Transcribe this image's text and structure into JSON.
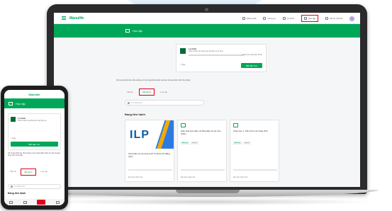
{
  "colors": {
    "brand_green": "#00a758",
    "highlight_red": "#e0001b",
    "ilp_blue": "#0f5ba8"
  },
  "brand": "Manulife",
  "topnav": {
    "links": [
      {
        "label": "Khám phá",
        "icon": "compass-icon"
      },
      {
        "label": "Công cụ",
        "icon": "tools-icon"
      },
      {
        "label": "Lộ trình",
        "icon": "route-icon"
      },
      {
        "label": "Học tập",
        "icon": "book-icon",
        "active": true
      },
      {
        "label": "Hồ sơ của tôi",
        "icon": "profile-icon"
      }
    ]
  },
  "header": {
    "title": "Học tập"
  },
  "program": {
    "title": "Lộ trình",
    "description": "Hoàn thành các khóa học để tiếp tục lộ trình",
    "status": "0 khóa học đã hoàn thành",
    "days": "7 ngày",
    "button": "Bắt đầu học"
  },
  "notice": "Tất cả các khóa học đã và đang có trên bảng điều khiển học tập của bạn được hiển thị tại đây.",
  "tabs": [
    "Tất cả",
    "Đã thích",
    "Lưu lại"
  ],
  "search": {
    "placeholder": "Tìm khóa học"
  },
  "section_title": "Đang tiến hành",
  "courses": [
    {
      "thumb_text": "ILP",
      "title": "Giới thiệu về chương trình Trưởng Tài Năng (ILP)",
      "footer": "Đã hoàn thành 0/1"
    },
    {
      "title": "Hiểu biết toàn diện về Manulife và các sản phẩm",
      "tags": [
        "Bắt buộc",
        "10 phút"
      ],
      "footer": "Đã hoàn thành 0/1"
    },
    {
      "title": "Khóa học 1: Kiến thức nền tảng (P2)",
      "tags": [
        "Bắt buộc",
        "10 phút"
      ],
      "footer": "Đã hoàn thành 0/1"
    }
  ],
  "phone": {
    "brand": "Manulife",
    "header_title": "Học tập",
    "program_title": "Lộ trình",
    "program_desc": "Hoàn thành các khóa học để tiếp tục",
    "program_days": "7 ngày",
    "program_button": "Bắt đầu học",
    "notice": "Tất cả các khóa học đã và đang có trên bảng điều khiển học tập của bạn được hiển thị tại đây.",
    "tabs": [
      "Tất cả",
      "Đã thích",
      "Lưu lại"
    ],
    "search_placeholder": "Tìm khóa học",
    "section_title": "Đang tiến hành"
  }
}
